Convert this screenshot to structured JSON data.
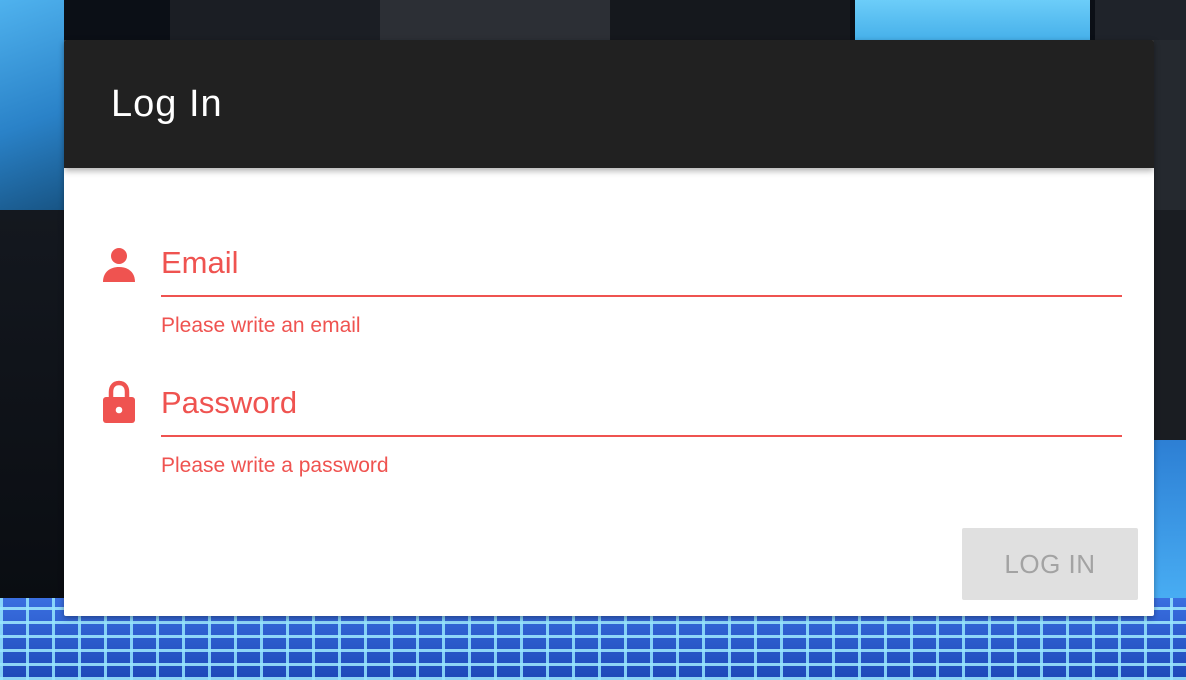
{
  "dialog": {
    "title": "Log In"
  },
  "fields": {
    "email": {
      "label": "Email",
      "error": "Please write an email",
      "icon": "person-icon"
    },
    "password": {
      "label": "Password",
      "error": "Please write a password",
      "icon": "lock-icon"
    }
  },
  "actions": {
    "login_label": "LOG IN"
  },
  "colors": {
    "header_bg": "#212121",
    "error": "#ef5350",
    "button_disabled_bg": "#e0e0e0",
    "button_disabled_text": "#a3a3a3"
  }
}
